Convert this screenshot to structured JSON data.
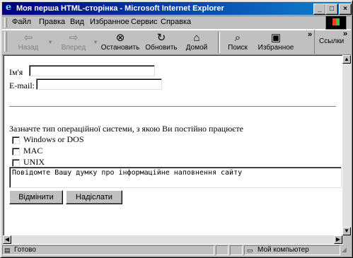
{
  "window": {
    "title": "Моя перша HTML-сторінка - Microsoft Internet Explorer",
    "minimize": "_",
    "maximize": "□",
    "close": "×"
  },
  "menu": [
    "Файл",
    "Правка",
    "Вид",
    "Избранное",
    "Сервис",
    "Справка"
  ],
  "toolbar": {
    "back": "Назад",
    "forward": "Вперед",
    "stop": "Остановить",
    "refresh": "Обновить",
    "home": "Домой",
    "search": "Поиск",
    "favorites": "Избранное",
    "links": "Ссылки",
    "more": "»"
  },
  "form": {
    "name_label": "Ім'я",
    "name_value": "",
    "email_label": "E-mail:",
    "email_value": "",
    "os_question": "Зазначте тип операційної системи, з якою Ви постійно працюєте",
    "os_options": [
      "Windows or DOS",
      "MAC",
      "UNIX"
    ],
    "comment": "Повідомте Вашу думку про інформаційне наповнення сайту",
    "reset_label": "Відмінити",
    "submit_label": "Надіслати"
  },
  "status": {
    "left": "Готово",
    "zone": "Мой компьютер"
  },
  "colors": {
    "title_start": "#000080",
    "title_end": "#1084d0",
    "chrome": "#c0c0c0"
  }
}
